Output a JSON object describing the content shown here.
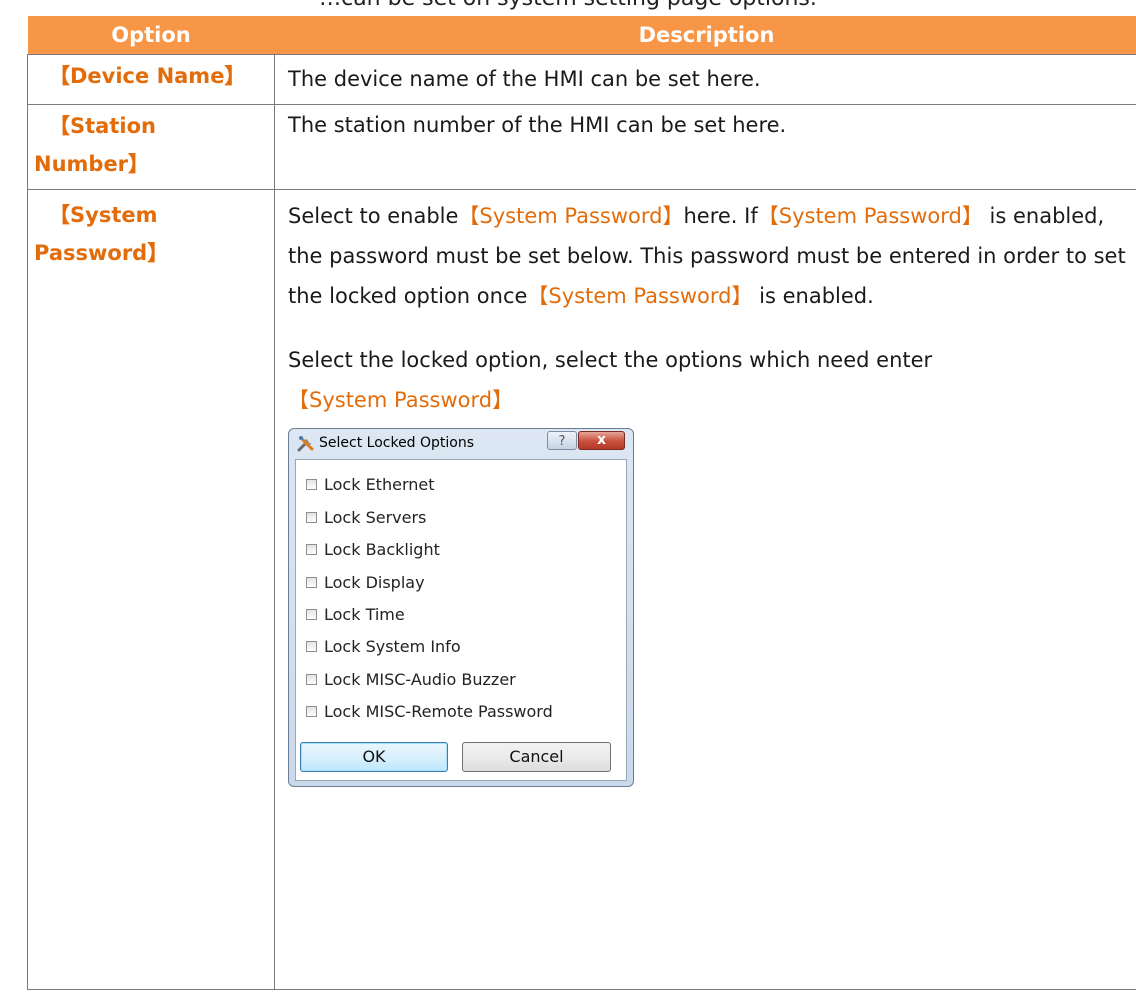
{
  "header": {
    "top_text": "…can be set on system setting page options.",
    "col_option": "Option",
    "col_description": "Description"
  },
  "rows": [
    {
      "option": "【Device Name】",
      "description": "The device name of the HMI can be set here."
    },
    {
      "option_line1": "【Station",
      "option_line2": "Number】",
      "description": "The station number of the HMI can be set here."
    },
    {
      "option_line1": "【System",
      "option_line2": "Password】",
      "desc_p1_a": "Select to enable",
      "desc_p1_hl1": "【System Password】",
      "desc_p1_b": "here. If",
      "desc_p1_hl2": "【System Password】",
      "desc_p1_c": "is enabled, the password must be set below. This password must be entered in order to set the locked option once",
      "desc_p1_hl3": "【System Password】",
      "desc_p1_d": " is enabled.",
      "desc_p2": "Select the locked option, select the options which need enter",
      "desc_p2_hl": "【System Password】"
    }
  ],
  "dialog": {
    "title": "Select Locked Options",
    "help": "?",
    "close": "x",
    "options": [
      "Lock Ethernet",
      "Lock Servers",
      "Lock Backlight",
      "Lock Display",
      "Lock Time",
      "Lock System Info",
      "Lock MISC-Audio Buzzer",
      "Lock MISC-Remote Password"
    ],
    "ok_label": "OK",
    "cancel_label": "Cancel"
  }
}
